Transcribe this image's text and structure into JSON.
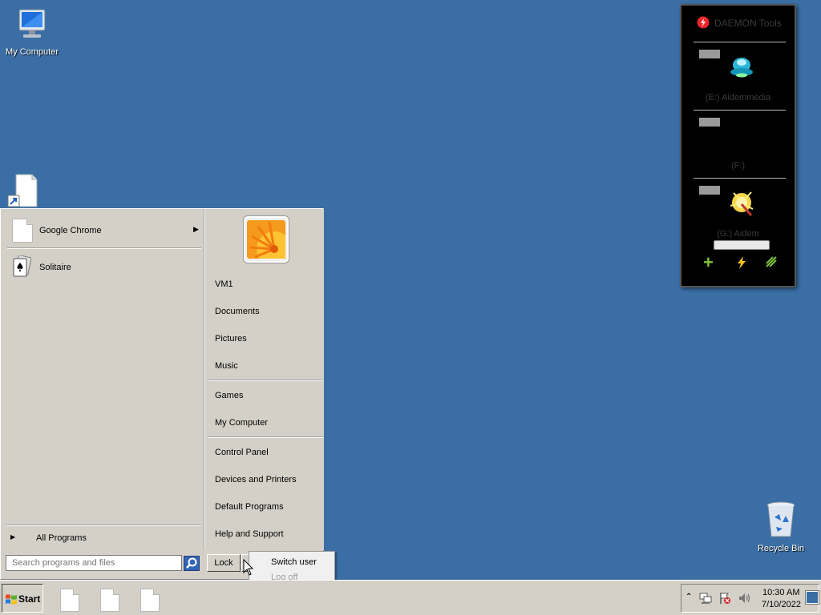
{
  "desktop": {
    "my_computer_label": "My Computer",
    "recycle_bin_label": "Recycle Bin"
  },
  "start_menu": {
    "pinned": [
      {
        "label": "Google Chrome",
        "has_submenu": true
      },
      {
        "label": "Solitaire",
        "has_submenu": false
      }
    ],
    "all_programs_label": "All Programs",
    "search_placeholder": "Search programs and files",
    "right_items": [
      "VM1",
      "Documents",
      "Pictures",
      "Music",
      "Games",
      "My Computer",
      "Control Panel",
      "Devices and Printers",
      "Default Programs",
      "Help and Support"
    ],
    "lock_label": "Lock",
    "power_submenu": [
      {
        "label": "Switch user",
        "enabled": true
      },
      {
        "label": "Log off",
        "enabled": false
      }
    ]
  },
  "taskbar": {
    "start_label": "Start",
    "clock_time": "10:30 AM",
    "clock_date": "7/10/2022"
  },
  "daemon_tools": {
    "title": "DAEMON Tools",
    "drives": [
      {
        "label": "(E:) Aidemmedia"
      },
      {
        "label": "(F:)"
      },
      {
        "label": "(G:) Aidem"
      }
    ],
    "colors": {
      "logo": "#e8262a",
      "add": "#7ec23c",
      "bolt": "#f0c020"
    }
  },
  "colors": {
    "desktop": "#3a6ea5",
    "chrome": "#d4d0c8"
  }
}
